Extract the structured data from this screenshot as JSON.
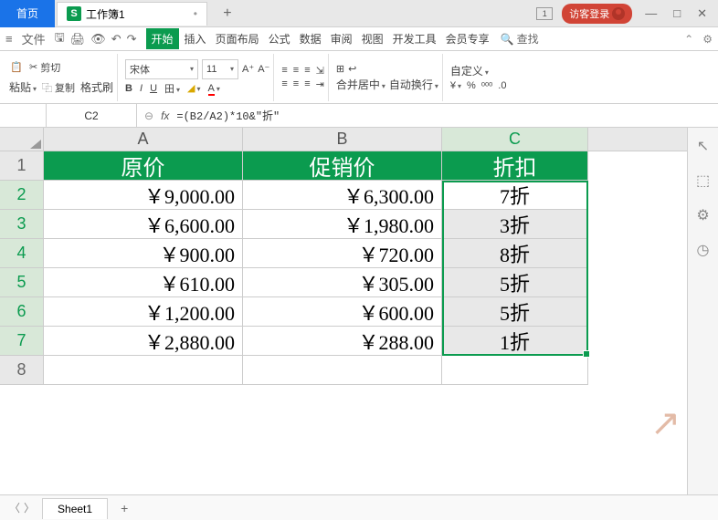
{
  "titlebar": {
    "home_tab": "首页",
    "file_tab": "工作簿1",
    "window_count": "1",
    "login": "访客登录"
  },
  "menubar": {
    "file": "文件",
    "tabs": [
      "开始",
      "插入",
      "页面布局",
      "公式",
      "数据",
      "审阅",
      "视图",
      "开发工具",
      "会员专享"
    ],
    "active_index": 0,
    "search": "查找"
  },
  "ribbon": {
    "cut": "剪切",
    "paste": "粘贴",
    "copy": "复制",
    "format_painter": "格式刷",
    "font_name": "宋体",
    "font_size": "11",
    "merge": "合并居中",
    "wrap": "自动换行",
    "custom": "自定义"
  },
  "formula_bar": {
    "cell_ref": "C2",
    "formula": "=(B2/A2)*10&\"折\""
  },
  "columns": [
    "A",
    "B",
    "C"
  ],
  "rows": [
    "1",
    "2",
    "3",
    "4",
    "5",
    "6",
    "7",
    "8"
  ],
  "data": {
    "headers": [
      "原价",
      "促销价",
      "折扣"
    ],
    "body": [
      [
        "￥9,000.00",
        "￥6,300.00",
        "7折"
      ],
      [
        "￥6,600.00",
        "￥1,980.00",
        "3折"
      ],
      [
        "￥900.00",
        "￥720.00",
        "8折"
      ],
      [
        "￥610.00",
        "￥305.00",
        "5折"
      ],
      [
        "￥1,200.00",
        "￥600.00",
        "5折"
      ],
      [
        "￥2,880.00",
        "￥288.00",
        "1折"
      ]
    ]
  },
  "sheet": {
    "name": "Sheet1"
  }
}
